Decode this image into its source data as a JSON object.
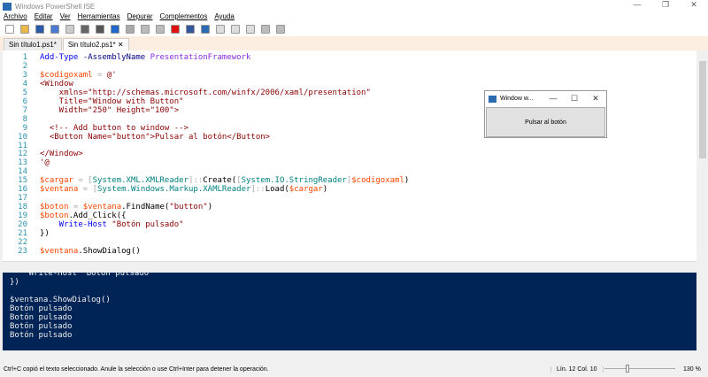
{
  "window": {
    "title": "Windows PowerShell ISE",
    "controls": [
      "—",
      "❐",
      "✕"
    ]
  },
  "menu": [
    "Archivo",
    "Editar",
    "Ver",
    "Herramientas",
    "Depurar",
    "Complementos",
    "Ayuda"
  ],
  "toolbar": [
    {
      "name": "new-icon",
      "color": "#ffffff"
    },
    {
      "name": "open-icon",
      "color": "#e8b84a"
    },
    {
      "name": "save-icon",
      "color": "#2a5aa8"
    },
    {
      "name": "cut-icon",
      "color": "#4a7bd0"
    },
    {
      "name": "copy-icon",
      "color": "#cccccc"
    },
    {
      "name": "paste-icon",
      "color": "#666666"
    },
    {
      "name": "clear-icon",
      "color": "#555555"
    },
    {
      "name": "undo-icon",
      "color": "#2266cc"
    },
    {
      "name": "redo-icon",
      "color": "#aaaaaa"
    },
    {
      "name": "run-icon",
      "color": "#bbbbbb"
    },
    {
      "name": "run-selection-icon",
      "color": "#bbbbbb"
    },
    {
      "name": "stop-icon",
      "color": "#dd1111"
    },
    {
      "name": "remote-icon",
      "color": "#335599"
    },
    {
      "name": "powershell-icon",
      "color": "#2b6cb0"
    },
    {
      "name": "layout-top-icon",
      "color": "#dddddd"
    },
    {
      "name": "layout-right-icon",
      "color": "#dddddd"
    },
    {
      "name": "layout-max-icon",
      "color": "#dddddd"
    },
    {
      "name": "snippets-icon",
      "color": "#bbbbbb"
    },
    {
      "name": "addons-icon",
      "color": "#bbbbbb"
    }
  ],
  "tabs": [
    {
      "label": "Sin título1.ps1*"
    },
    {
      "label": "Sin título2.ps1*",
      "close": "✕"
    }
  ],
  "editor": {
    "lines": [
      [
        [
          "Add-Type",
          "cmd"
        ],
        [
          " -AssemblyName ",
          "par"
        ],
        [
          "PresentationFramework",
          "mem"
        ]
      ],
      [],
      [
        [
          "$codigoxaml",
          "var"
        ],
        [
          " = ",
          "op"
        ],
        [
          "@'",
          "str"
        ]
      ],
      [
        [
          "<Window",
          "str"
        ]
      ],
      [
        [
          "    xmlns=\"http://schemas.microsoft.com/winfx/2006/xaml/presentation\"",
          "str"
        ]
      ],
      [
        [
          "    Title=\"Window with Button\"",
          "str"
        ]
      ],
      [
        [
          "    Width=\"250\" Height=\"100\">",
          "str"
        ]
      ],
      [],
      [
        [
          "  <!-- Add button to window -->",
          "str"
        ]
      ],
      [
        [
          "  <Button Name=\"button\">Pulsar al botón</Button>",
          "str"
        ]
      ],
      [],
      [
        [
          "</Window>",
          "str"
        ]
      ],
      [
        [
          "'@",
          "str"
        ]
      ],
      [],
      [
        [
          "$cargar",
          "var"
        ],
        [
          " = ",
          "op"
        ],
        [
          "[",
          "op"
        ],
        [
          "System.XML.XMLReader",
          "typ"
        ],
        [
          "]::",
          "op"
        ],
        [
          "Create(",
          "def"
        ],
        [
          "[",
          "op"
        ],
        [
          "System.IO.StringReader",
          "typ"
        ],
        [
          "]",
          "op"
        ],
        [
          "$codigoxaml",
          "var"
        ],
        [
          ")",
          "def"
        ]
      ],
      [
        [
          "$ventana",
          "var"
        ],
        [
          " = ",
          "op"
        ],
        [
          "[",
          "op"
        ],
        [
          "System.Windows.Markup.XAMLReader",
          "typ"
        ],
        [
          "]::",
          "op"
        ],
        [
          "Load(",
          "def"
        ],
        [
          "$cargar",
          "var"
        ],
        [
          ")",
          "def"
        ]
      ],
      [],
      [
        [
          "$boton",
          "var"
        ],
        [
          " = ",
          "op"
        ],
        [
          "$ventana",
          "var"
        ],
        [
          ".FindName(",
          "def"
        ],
        [
          "\"button\"",
          "str"
        ],
        [
          ")",
          "def"
        ]
      ],
      [
        [
          "$boton",
          "var"
        ],
        [
          ".Add_Click({",
          "def"
        ]
      ],
      [
        [
          "    Write-Host",
          "cmd"
        ],
        [
          " ",
          "def"
        ],
        [
          "\"Botón pulsado\"",
          "str"
        ]
      ],
      [
        [
          "})",
          "def"
        ]
      ],
      [],
      [
        [
          "$ventana",
          "var"
        ],
        [
          ".ShowDialog()",
          "def"
        ]
      ]
    ]
  },
  "console": {
    "lines": [
      "    Write-Host \"Botón pulsado\"",
      "})",
      "",
      "$ventana.ShowDialog()",
      "Botón pulsado",
      "Botón pulsado",
      "Botón pulsado",
      "Botón pulsado"
    ]
  },
  "popup": {
    "title": "Window w...",
    "button": "Pulsar al botón"
  },
  "status": {
    "message": "Ctrl+C copió el texto seleccionado. Anule la selección o use Ctrl+Inter para detener la operación.",
    "position": "Lín. 12  Col. 10",
    "zoom_percent": "130 %",
    "zoom_level": 130
  }
}
